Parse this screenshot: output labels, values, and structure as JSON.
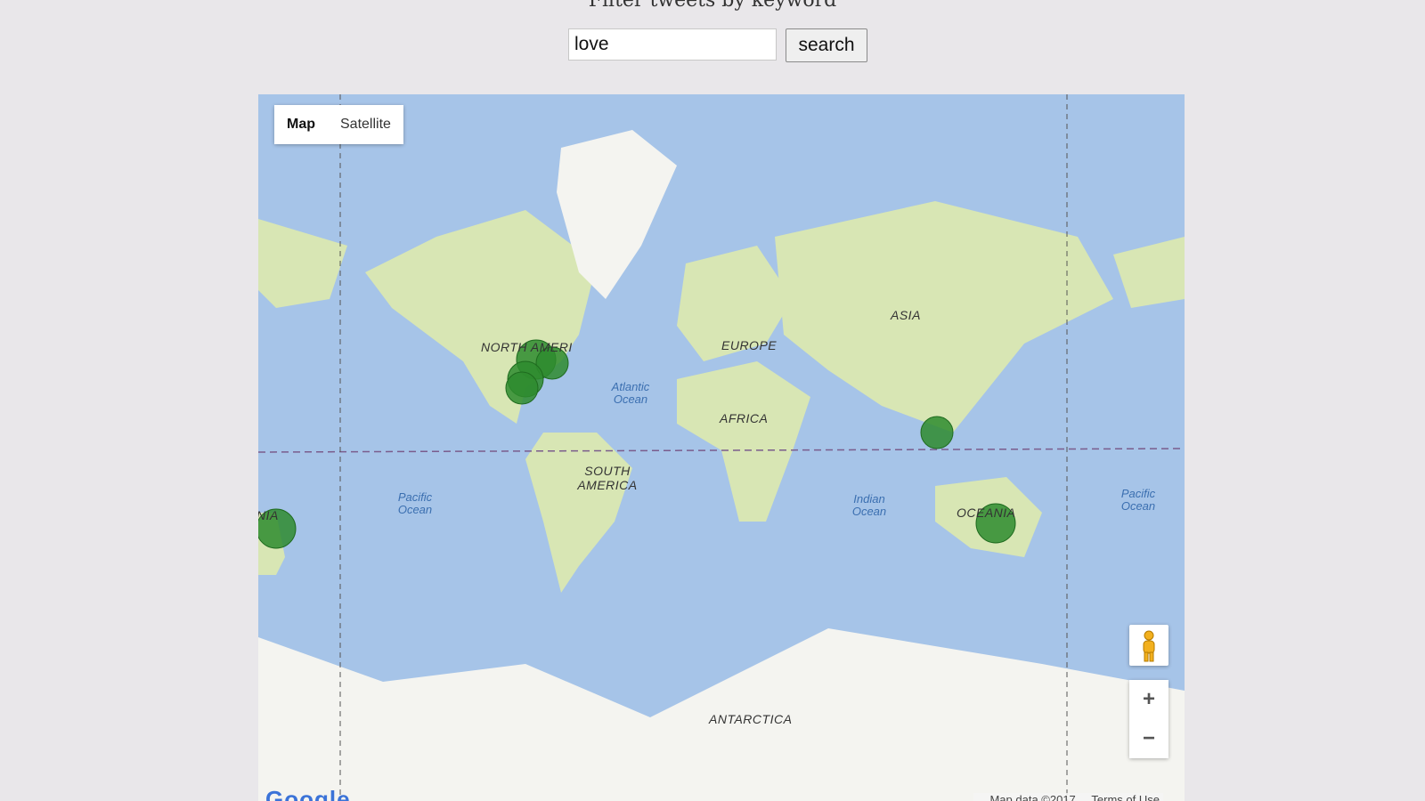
{
  "page": {
    "heading": "Filter tweets by keyword"
  },
  "search": {
    "value": "love",
    "button_label": "search"
  },
  "map": {
    "type_control": {
      "options": [
        "Map",
        "Satellite"
      ],
      "selected": "Map"
    },
    "continent_labels": {
      "north_america": "NORTH AMERI",
      "south_america": "SOUTH AMERICA",
      "europe": "EUROPE",
      "africa": "AFRICA",
      "asia": "ASIA",
      "oceania": "OCEANIA",
      "antarctica": "ANTARCTICA",
      "oceania_wrapped": "NIA"
    },
    "ocean_labels": {
      "atlantic": "Atlantic Ocean",
      "pacific_west": "Pacific Ocean",
      "indian": "Indian Ocean",
      "pacific_east": "Pacific Ocean"
    },
    "zoom_in_label": "+",
    "zoom_out_label": "−",
    "attribution": "Map data ©2017",
    "terms_link": "Terms of Use",
    "logo": "Google",
    "colors": {
      "water": "#a6c4e8",
      "land": "#d8e6b4",
      "ice": "#f4f4f0",
      "marker": "#2e8b2e"
    }
  }
}
